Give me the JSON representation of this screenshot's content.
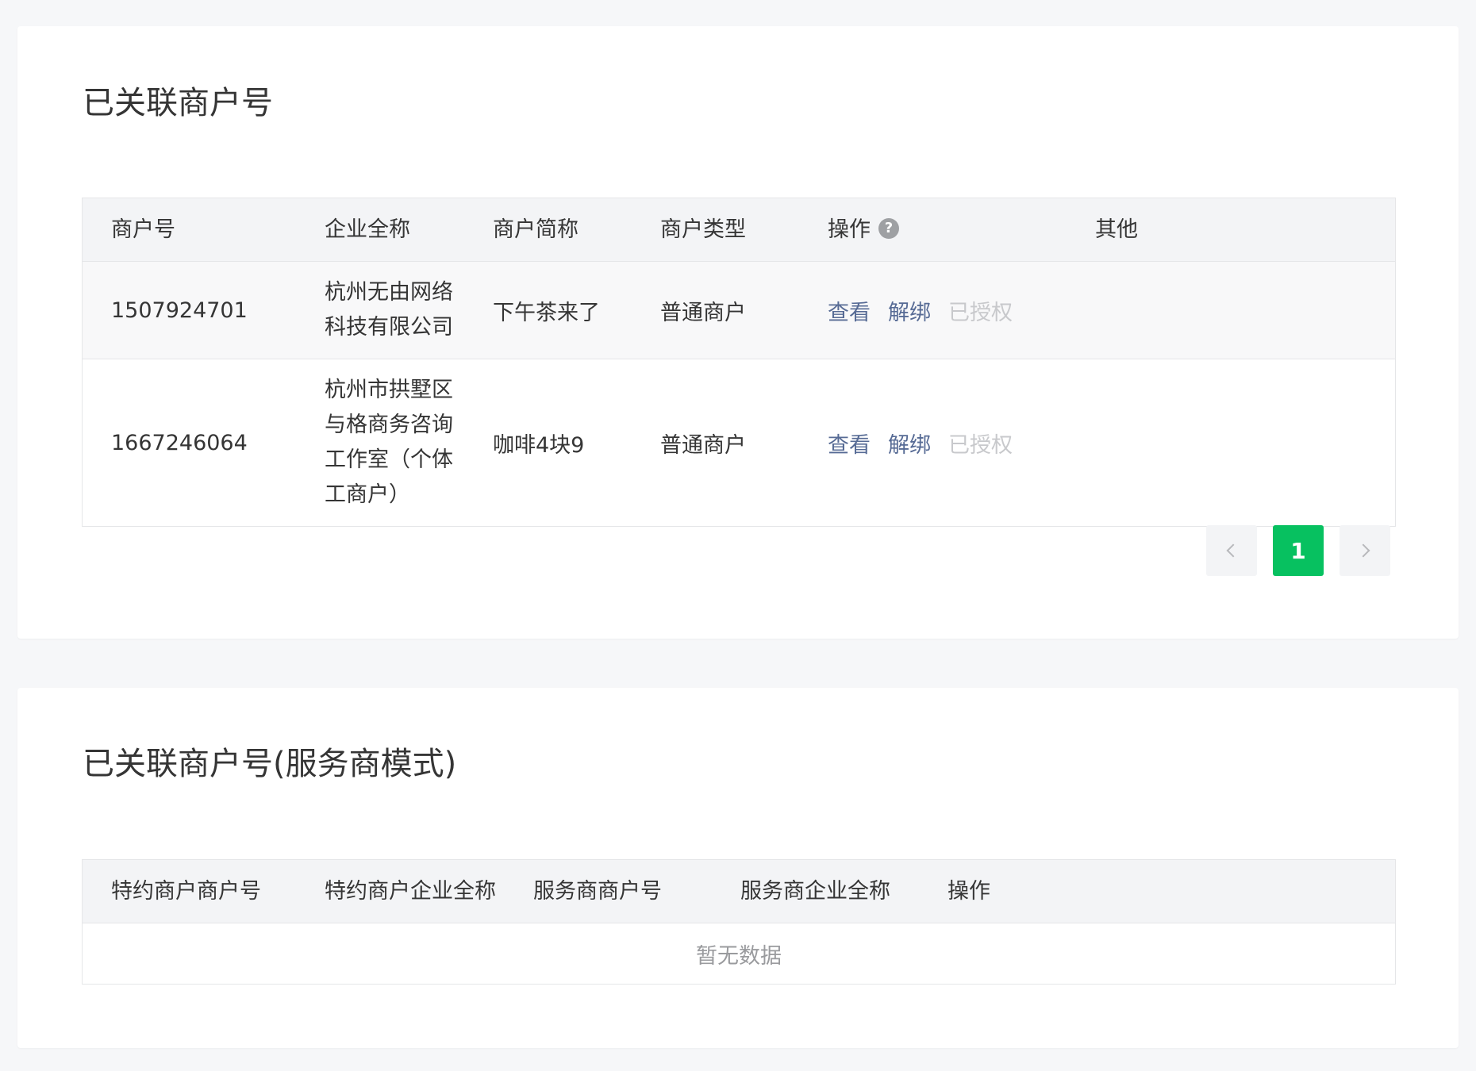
{
  "linked": {
    "title": "已关联商户号",
    "columns": {
      "merchant_id": "商户号",
      "company_name": "企业全称",
      "short_name": "商户简称",
      "type": "商户类型",
      "actions": "操作",
      "other": "其他"
    },
    "rows": [
      {
        "merchant_id": "1507924701",
        "company_name": "杭州无由网络科技有限公司",
        "short_name": "下午茶来了",
        "type": "普通商户",
        "action_view": "查看",
        "action_unbind": "解绑",
        "action_authorized": "已授权",
        "other": ""
      },
      {
        "merchant_id": "1667246064",
        "company_name": "杭州市拱墅区与格商务咨询工作室（个体工商户）",
        "short_name": "咖啡4块9",
        "type": "普通商户",
        "action_view": "查看",
        "action_unbind": "解绑",
        "action_authorized": "已授权",
        "other": ""
      }
    ],
    "pagination": {
      "current_page": "1"
    }
  },
  "service": {
    "title": "已关联商户号(服务商模式)",
    "columns": {
      "special_merchant_id": "特约商户商户号",
      "special_company_name": "特约商户企业全称",
      "provider_merchant_id": "服务商商户号",
      "provider_company_name": "服务商企业全称",
      "actions": "操作"
    },
    "empty_text": "暂无数据"
  },
  "colors": {
    "page_bg": "#f6f7f9",
    "link": "#576b95",
    "disabled_link": "#c8c9cc",
    "accent_green": "#07c160",
    "header_bg": "#f3f4f6"
  },
  "icons": {
    "help": "question-circle-icon",
    "prev": "chevron-left-icon",
    "next": "chevron-right-icon"
  }
}
